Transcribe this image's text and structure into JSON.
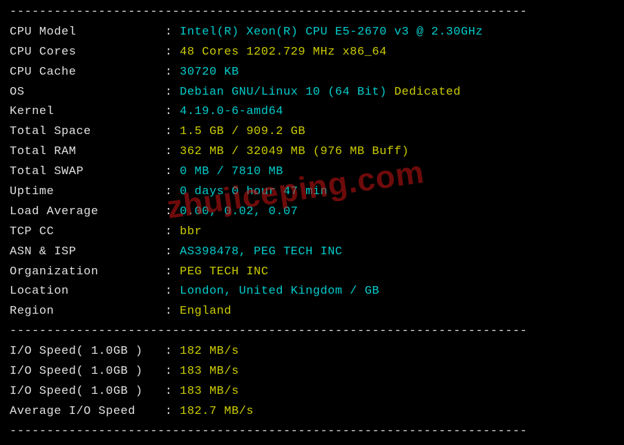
{
  "dividers": {
    "top": "----------------------------------------------------------------------",
    "mid": "----------------------------------------------------------------------",
    "bot": "----------------------------------------------------------------------"
  },
  "rows": [
    {
      "label": "CPU Model            ",
      "value": [
        {
          "t": "Intel(R) Xeon(R) CPU E5-2670 v3 @ 2.30GHz",
          "c": "cyan"
        }
      ]
    },
    {
      "label": "CPU Cores            ",
      "value": [
        {
          "t": "48 Cores 1202.729 MHz x86_64",
          "c": "yellow"
        }
      ]
    },
    {
      "label": "CPU Cache            ",
      "value": [
        {
          "t": "30720 KB",
          "c": "cyan"
        }
      ]
    },
    {
      "label": "OS                   ",
      "value": [
        {
          "t": "Debian GNU/Linux 10 (64 Bit) ",
          "c": "cyan"
        },
        {
          "t": "Dedicated",
          "c": "yellow"
        }
      ]
    },
    {
      "label": "Kernel               ",
      "value": [
        {
          "t": "4.19.0-6-amd64",
          "c": "cyan"
        }
      ]
    },
    {
      "label": "Total Space          ",
      "value": [
        {
          "t": "1.5 GB / 909.2 GB",
          "c": "yellow"
        }
      ]
    },
    {
      "label": "Total RAM            ",
      "value": [
        {
          "t": "362 MB / 32049 MB (976 MB Buff)",
          "c": "yellow"
        }
      ]
    },
    {
      "label": "Total SWAP           ",
      "value": [
        {
          "t": "0 MB / 7810 MB",
          "c": "cyan"
        }
      ]
    },
    {
      "label": "Uptime               ",
      "value": [
        {
          "t": "0 days 0 hour 47 min",
          "c": "cyan"
        }
      ]
    },
    {
      "label": "Load Average         ",
      "value": [
        {
          "t": "0.00, 0.02, 0.07",
          "c": "cyan"
        }
      ]
    },
    {
      "label": "TCP CC               ",
      "value": [
        {
          "t": "bbr",
          "c": "yellow"
        }
      ]
    },
    {
      "label": "ASN & ISP            ",
      "value": [
        {
          "t": "AS398478, PEG TECH INC",
          "c": "cyan"
        }
      ]
    },
    {
      "label": "Organization         ",
      "value": [
        {
          "t": "PEG TECH INC",
          "c": "yellow"
        }
      ]
    },
    {
      "label": "Location             ",
      "value": [
        {
          "t": "London, United Kingdom / GB",
          "c": "cyan"
        }
      ]
    },
    {
      "label": "Region               ",
      "value": [
        {
          "t": "England",
          "c": "yellow"
        }
      ]
    }
  ],
  "io_rows": [
    {
      "label": "I/O Speed( 1.0GB )   ",
      "value": [
        {
          "t": "182 MB/s",
          "c": "yellow"
        }
      ]
    },
    {
      "label": "I/O Speed( 1.0GB )   ",
      "value": [
        {
          "t": "183 MB/s",
          "c": "yellow"
        }
      ]
    },
    {
      "label": "I/O Speed( 1.0GB )   ",
      "value": [
        {
          "t": "183 MB/s",
          "c": "yellow"
        }
      ]
    },
    {
      "label": "Average I/O Speed    ",
      "value": [
        {
          "t": "182.7 MB/s",
          "c": "yellow"
        }
      ]
    }
  ],
  "watermark": "zhujiceping.com"
}
